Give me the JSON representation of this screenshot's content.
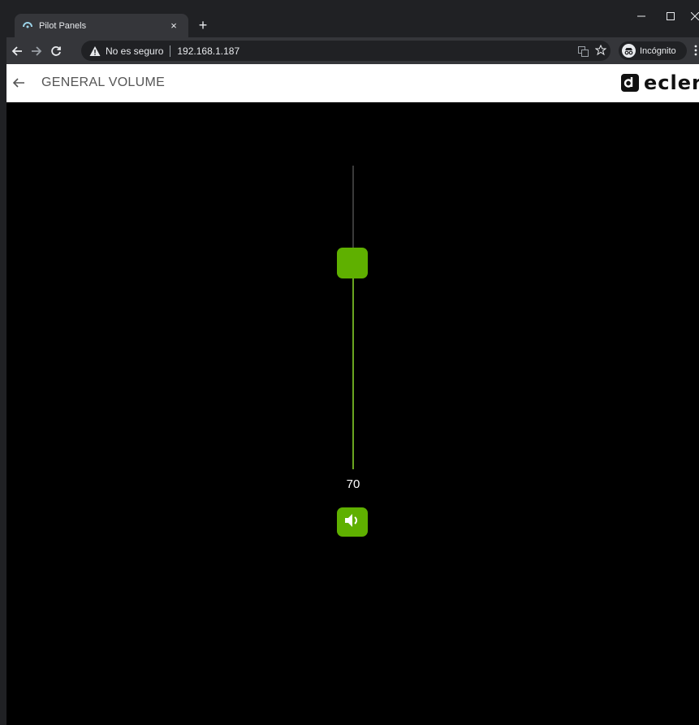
{
  "browser": {
    "tab_title": "Pilot Panels",
    "tab_close": "×",
    "new_tab": "+",
    "security_label": "No es seguro",
    "url": "192.168.1.187",
    "incognito_label": "Incógnito"
  },
  "header": {
    "title": "GENERAL VOLUME",
    "logo_text": "ecler"
  },
  "volume": {
    "value": "70",
    "level_percent": 70
  },
  "colors": {
    "accent": "#5fb000",
    "page_background": "#000000",
    "header_background": "#ffffff"
  }
}
